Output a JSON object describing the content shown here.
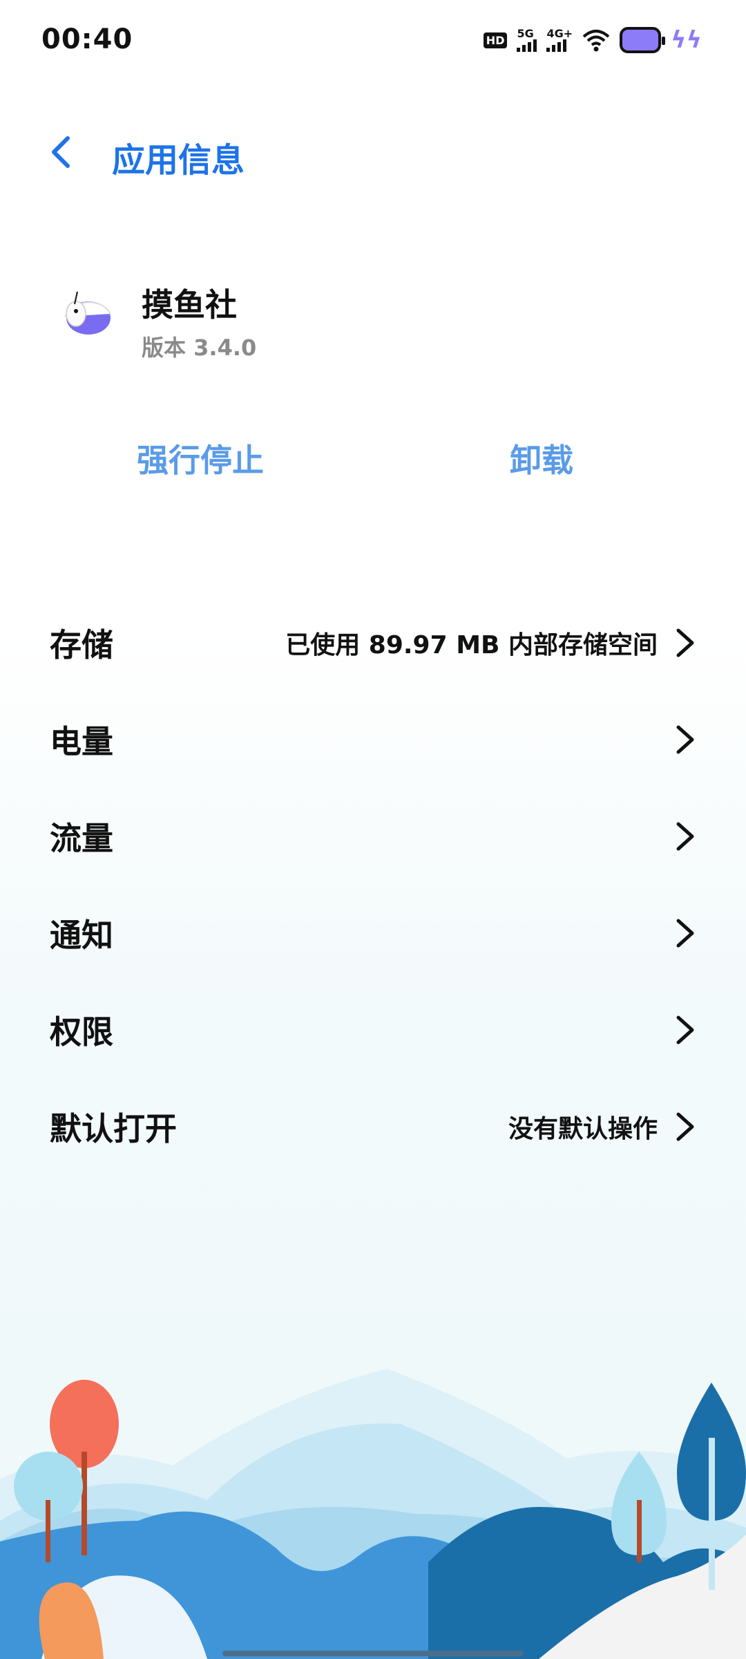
{
  "status_bar": {
    "time": "00:40",
    "hd_label": "HD",
    "sim1_label": "5G",
    "sim2_label": "4G+",
    "icons": [
      "hd-icon",
      "5g-signal-icon",
      "4g-signal-icon",
      "wifi-icon",
      "battery-icon",
      "charging-icon"
    ]
  },
  "header": {
    "title": "应用信息",
    "back_icon": "chevron-left-icon"
  },
  "app": {
    "name": "摸鱼社",
    "version": "版本 3.4.0"
  },
  "actions": {
    "force_stop": "强行停止",
    "uninstall": "卸载"
  },
  "settings": [
    {
      "label": "存储",
      "value": "已使用 89.97 MB 内部存储空间"
    },
    {
      "label": "电量",
      "value": ""
    },
    {
      "label": "流量",
      "value": ""
    },
    {
      "label": "通知",
      "value": ""
    },
    {
      "label": "权限",
      "value": ""
    },
    {
      "label": "默认打开",
      "value": "没有默认操作"
    }
  ],
  "colors": {
    "accent": "#1e73e8",
    "action": "#5a9be8",
    "battery": "#8d7cf7"
  }
}
